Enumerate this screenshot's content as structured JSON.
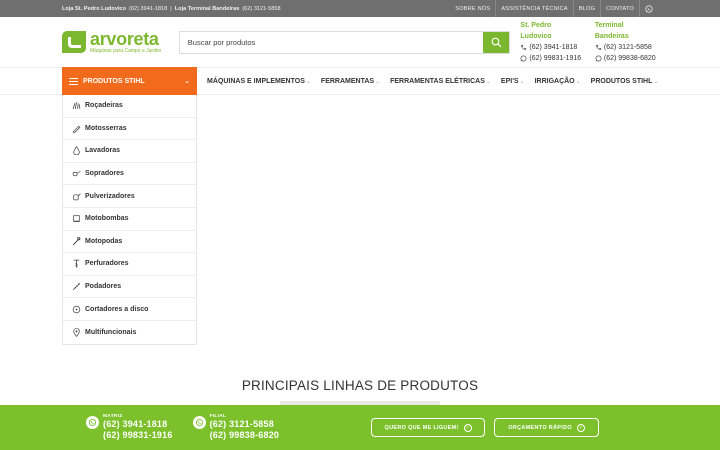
{
  "topbar": {
    "store1_label": "Loja St. Pedro Ludovico",
    "store1_phone": "(62) 3941-1818",
    "separator": "|",
    "store2_label": "Loja Terminal Bandeiras",
    "store2_phone": "(62) 3121-5858",
    "links": [
      "SOBRE NÓS",
      "ASSISTÊNCIA TÉCNICA",
      "BLOG",
      "CONTATO"
    ]
  },
  "header": {
    "brand": "arvoreta",
    "tagline": "Máquinas para Campo e Jardim",
    "search_placeholder": "Buscar por produtos",
    "contacts": [
      {
        "title": "St. Pedro Ludovico",
        "phone": "(62) 3941-1818",
        "whatsapp": "(62) 99831-1916"
      },
      {
        "title": "Terminal Bandeiras",
        "phone": "(62) 3121-5858",
        "whatsapp": "(62) 99838-6820"
      }
    ]
  },
  "nav": {
    "category_button": "PRODUTOS STIHL",
    "menu": [
      "MÁQUINAS E IMPLEMENTOS",
      "FERRAMENTAS",
      "FERRAMENTAS ELÉTRICAS",
      "EPI'S",
      "IRRIGAÇÃO",
      "PRODUTOS STIHL"
    ]
  },
  "sidebar": {
    "items": [
      {
        "label": "Roçadeiras",
        "icon": "grass-trimmer-icon"
      },
      {
        "label": "Motosserras",
        "icon": "chainsaw-icon"
      },
      {
        "label": "Lavadoras",
        "icon": "water-drop-icon"
      },
      {
        "label": "Sopradores",
        "icon": "blower-icon"
      },
      {
        "label": "Pulverizadores",
        "icon": "sprayer-icon"
      },
      {
        "label": "Motobombas",
        "icon": "water-pump-icon"
      },
      {
        "label": "Motopodas",
        "icon": "pole-pruner-icon"
      },
      {
        "label": "Perfuradores",
        "icon": "auger-icon"
      },
      {
        "label": "Podadores",
        "icon": "hedge-trimmer-icon"
      },
      {
        "label": "Cortadores a disco",
        "icon": "cut-off-saw-icon"
      },
      {
        "label": "Multifuncionais",
        "icon": "multi-tool-icon"
      }
    ]
  },
  "main": {
    "section_title": "PRINCIPAIS LINHAS DE PRODUTOS"
  },
  "footer_bar": {
    "phones": [
      {
        "label": "MATRIZ",
        "phone1": "(62) 3941-1818",
        "phone2": "(62) 99831-1916"
      },
      {
        "label": "FILIAL",
        "phone1": "(62) 3121-5858",
        "phone2": "(62) 99838-6820"
      }
    ],
    "call_me_button": "QUERO QUE ME LIGUEM!",
    "quote_button": "ORÇAMENTO RÁPIDO"
  },
  "colors": {
    "brand_green": "#7cb82f",
    "accent_orange": "#f26b1d",
    "topbar_gray": "#6f6f6f",
    "footer_green": "#7cc12b"
  }
}
